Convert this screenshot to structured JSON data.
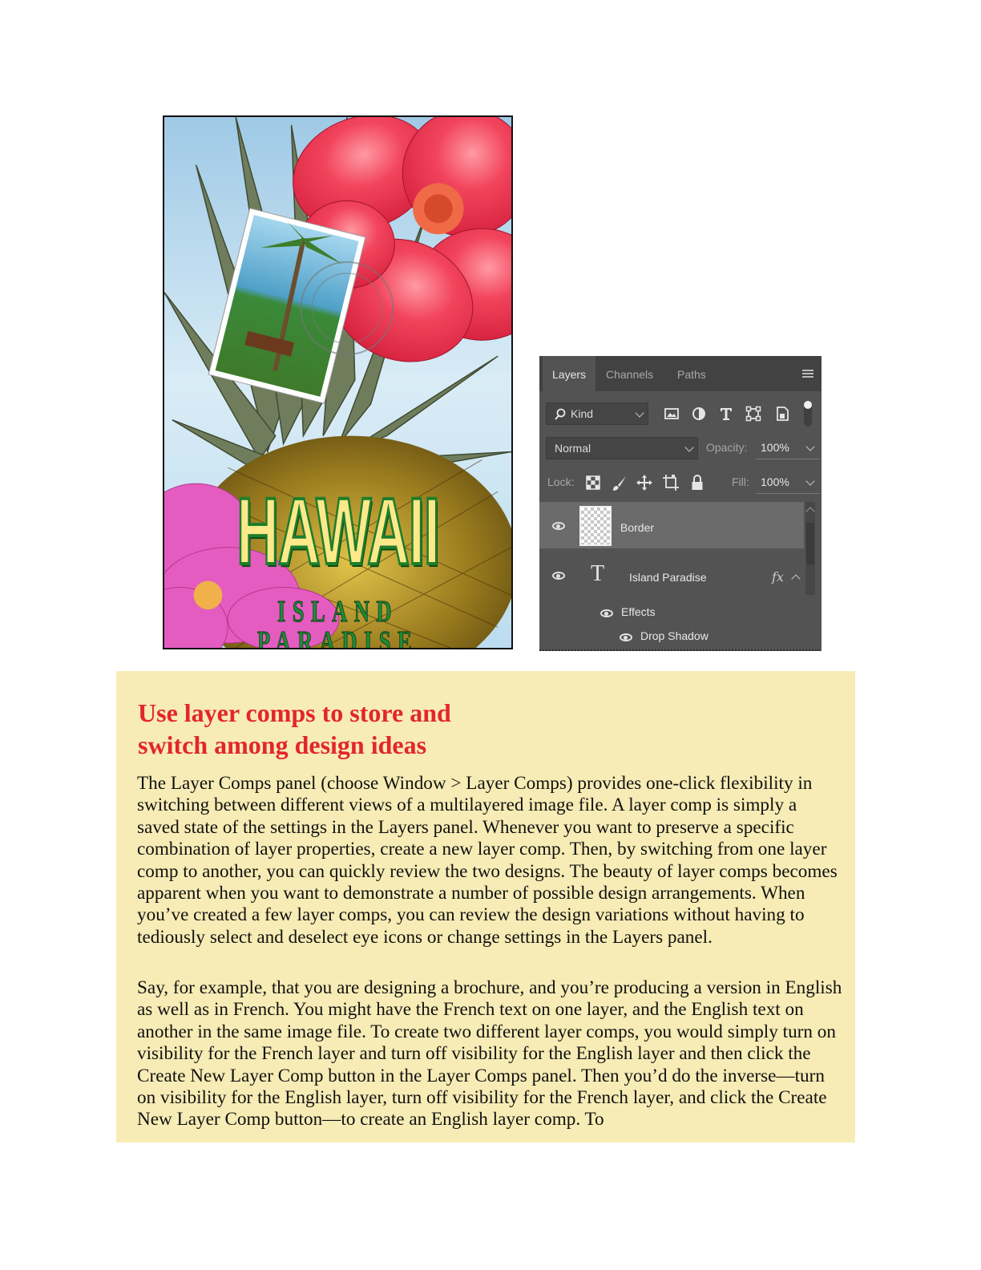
{
  "poster": {
    "title": "HAWAII",
    "subtitle": "ISLAND PARADISE"
  },
  "layers_panel": {
    "tabs": [
      {
        "label": "Layers",
        "active": true
      },
      {
        "label": "Channels",
        "active": false
      },
      {
        "label": "Paths",
        "active": false
      }
    ],
    "filter": {
      "label": "Kind"
    },
    "blend_mode": "Normal",
    "opacity_label": "Opacity:",
    "opacity_value": "100%",
    "lock_label": "Lock:",
    "fill_label": "Fill:",
    "fill_value": "100%",
    "layers": [
      {
        "name": "Border",
        "selected": true,
        "visible": true
      },
      {
        "name": "Island Paradise",
        "selected": false,
        "visible": true,
        "fx": "fx"
      }
    ],
    "effects_label": "Effects",
    "effect_items": [
      "Drop Shadow"
    ],
    "icons": [
      "search-icon",
      "image-filter-icon",
      "adjustment-filter-icon",
      "type-filter-icon",
      "shape-filter-icon",
      "smart-object-filter-icon",
      "filter-toggle-icon",
      "panel-menu-icon",
      "lock-transparent-icon",
      "lock-image-icon",
      "lock-position-icon",
      "lock-artboard-icon",
      "lock-all-icon",
      "eye-icon",
      "type-layer-icon"
    ]
  },
  "sidebar": {
    "heading": "Use layer comps to store and switch among design ideas",
    "paragraphs": [
      "The Layer Comps panel (choose Window > Layer Comps) provides one-click flexibility in switching between different views of a multilayered image file. A layer comp is simply a saved state of the settings in the Layers panel. Whenever you want to preserve a specific combination of layer properties, create a new layer comp. Then, by switching from one layer comp to another, you can quickly review the two designs. The beauty of layer comps becomes apparent when you want to demonstrate a number of possible design arrangements. When you’ve created a few layer comps, you can review the design variations without having to tediously select and deselect eye icons or change settings in the Layers panel.",
      "Say, for example, that you are designing a brochure, and you’re producing a version in English as well as in French. You might have the French text on one layer, and the English text on another in the same image file. To create two different layer comps, you would simply turn on visibility for the French layer and turn off visibility for the English layer and then click the Create New Layer Comp button in the Layer Comps panel. Then you’d do the inverse—turn on visibility for the English layer, turn off visibility for the French layer, and click the Create New Layer Comp button—to create an English layer comp. To"
    ]
  },
  "colors": {
    "heading": "#e3262b",
    "sidebar_bg": "#f7ecb5",
    "panel_bg": "#535353"
  }
}
